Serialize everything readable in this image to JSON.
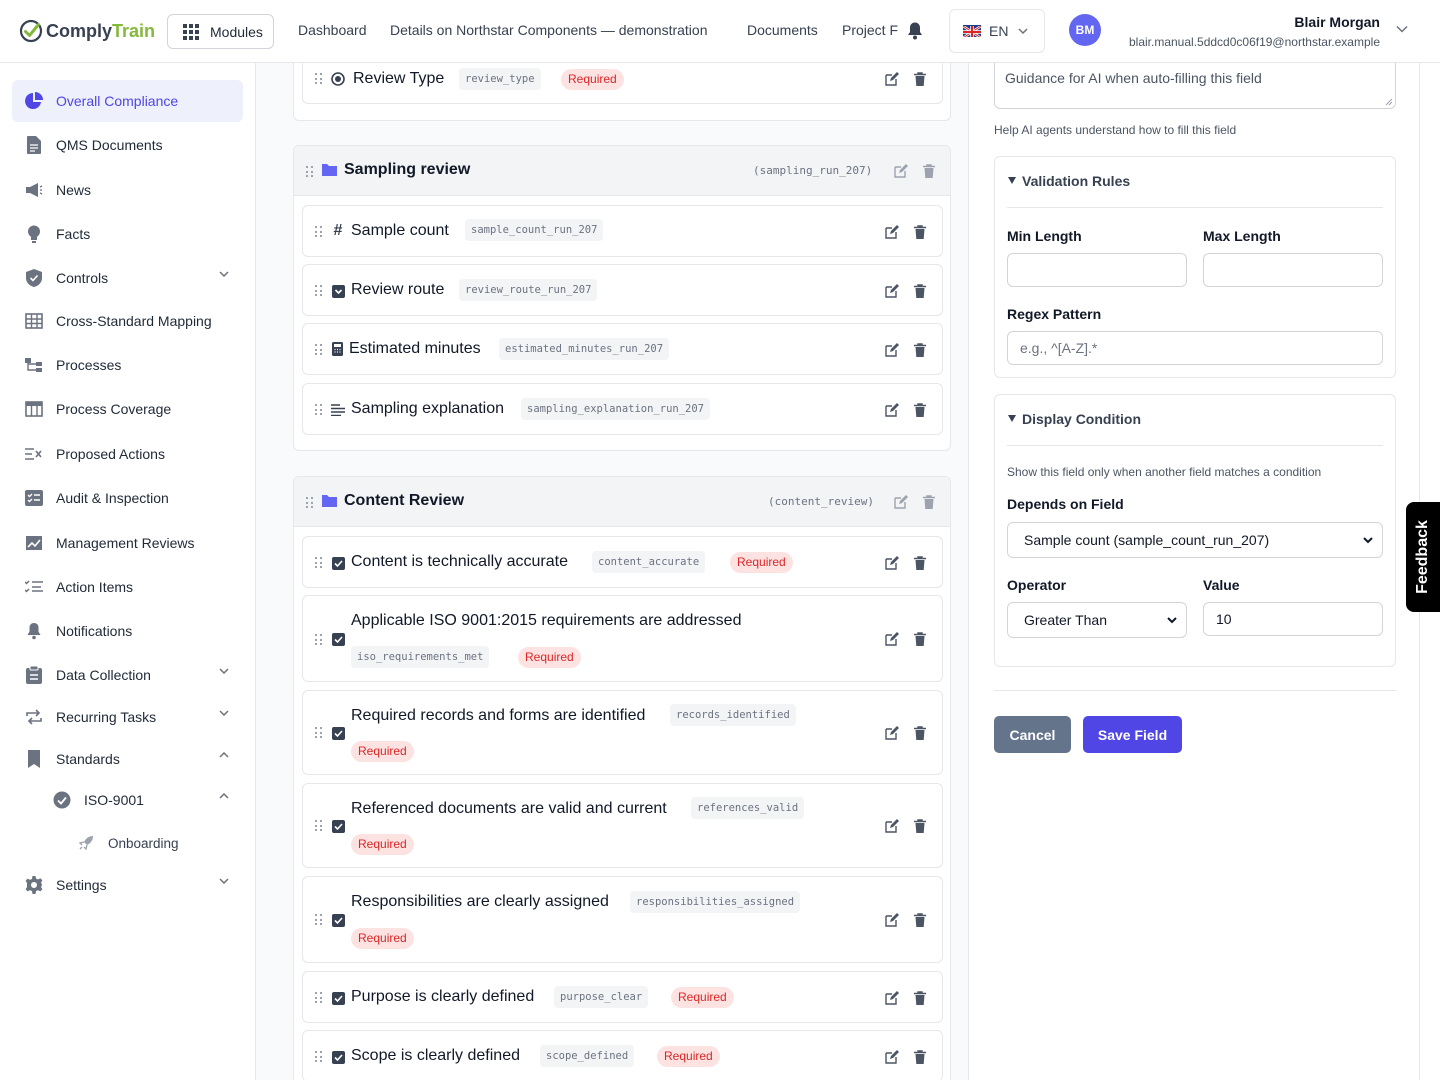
{
  "app": {
    "brand_a": "Comply",
    "brand_b": "Train"
  },
  "header": {
    "modules_label": "Modules",
    "nav": [
      "Dashboard",
      "Details on Northstar Components — demonstration",
      "Documents",
      "Project F"
    ],
    "language": "EN",
    "user_initials": "BM",
    "user_name": "Blair Morgan",
    "user_email": "blair.manual.5ddcd0c06f19@northstar.example"
  },
  "sidebar": {
    "items": [
      {
        "label": "Overall Compliance",
        "icon": "pie-chart-icon",
        "active": true
      },
      {
        "label": "QMS Documents",
        "icon": "document-icon"
      },
      {
        "label": "News",
        "icon": "megaphone-icon"
      },
      {
        "label": "Facts",
        "icon": "lightbulb-icon"
      },
      {
        "label": "Controls",
        "icon": "shield-icon",
        "expandable": true
      },
      {
        "label": "Cross-Standard Mapping",
        "icon": "table-icon"
      },
      {
        "label": "Processes",
        "icon": "flow-icon"
      },
      {
        "label": "Process Coverage",
        "icon": "columns-icon"
      },
      {
        "label": "Proposed Actions",
        "icon": "list-x-icon"
      },
      {
        "label": "Audit & Inspection",
        "icon": "checklist-icon"
      },
      {
        "label": "Management Reviews",
        "icon": "chart-line-icon"
      },
      {
        "label": "Action Items",
        "icon": "task-list-icon"
      },
      {
        "label": "Notifications",
        "icon": "bell-icon"
      },
      {
        "label": "Data Collection",
        "icon": "clipboard-icon",
        "expandable": true
      },
      {
        "label": "Recurring Tasks",
        "icon": "repeat-icon",
        "expandable": true
      },
      {
        "label": "Standards",
        "icon": "bookmark-icon",
        "expanded": true
      },
      {
        "label": "ISO-9001",
        "icon": "badge-check-icon",
        "expanded": true
      },
      {
        "label": "Onboarding",
        "icon": "rocket-icon"
      },
      {
        "label": "Settings",
        "icon": "gear-icon",
        "expandable": true
      }
    ]
  },
  "form": {
    "top_field": {
      "name": "Review Type",
      "key": "review_type",
      "required": "Required"
    },
    "groups": [
      {
        "title": "Sampling review",
        "key": "(sampling_run_207)",
        "fields": [
          {
            "name": "Sample count",
            "key": "sample_count_run_207",
            "icon": "hash-icon"
          },
          {
            "name": "Review route",
            "key": "review_route_run_207",
            "icon": "dropdown-icon"
          },
          {
            "name": "Estimated minutes",
            "key": "estimated_minutes_run_207",
            "icon": "calculator-icon"
          },
          {
            "name": "Sampling explanation",
            "key": "sampling_explanation_run_207",
            "icon": "text-lines-icon"
          }
        ]
      },
      {
        "title": "Content Review",
        "key": "(content_review)",
        "fields": [
          {
            "name": "Content is technically accurate",
            "key": "content_accurate",
            "required": "Required"
          },
          {
            "name": "Applicable ISO 9001:2015 requirements are addressed",
            "key": "iso_requirements_met",
            "required": "Required"
          },
          {
            "name": "Required records and forms are identified",
            "key": "records_identified",
            "required": "Required"
          },
          {
            "name": "Referenced documents are valid and current",
            "key": "references_valid",
            "required": "Required"
          },
          {
            "name": "Responsibilities are clearly assigned",
            "key": "responsibilities_assigned",
            "required": "Required"
          },
          {
            "name": "Purpose is clearly defined",
            "key": "purpose_clear",
            "required": "Required"
          },
          {
            "name": "Scope is clearly defined",
            "key": "scope_defined",
            "required": "Required"
          }
        ]
      }
    ]
  },
  "panel": {
    "ai_guidance_placeholder": "Guidance for AI when auto-filling this field",
    "ai_help": "Help AI agents understand how to fill this field",
    "validation": {
      "title": "Validation Rules",
      "min_length_label": "Min Length",
      "min_length_value": "",
      "max_length_label": "Max Length",
      "max_length_value": "",
      "regex_label": "Regex Pattern",
      "regex_placeholder": "e.g., ^[A-Z].*"
    },
    "display_condition": {
      "title": "Display Condition",
      "description": "Show this field only when another field matches a condition",
      "depends_label": "Depends on Field",
      "depends_value": "Sample count (sample_count_run_207)",
      "operator_label": "Operator",
      "operator_value": "Greater Than",
      "value_label": "Value",
      "value": "10"
    },
    "cancel_label": "Cancel",
    "save_label": "Save Field"
  },
  "feedback_label": "Feedback",
  "colors": {
    "primary": "#4f46e5",
    "cancel": "#64748b",
    "required_bg": "#fde2e2",
    "required_text": "#dc2626",
    "brand_green": "#84b83a",
    "group_icon": "#6366f1"
  }
}
